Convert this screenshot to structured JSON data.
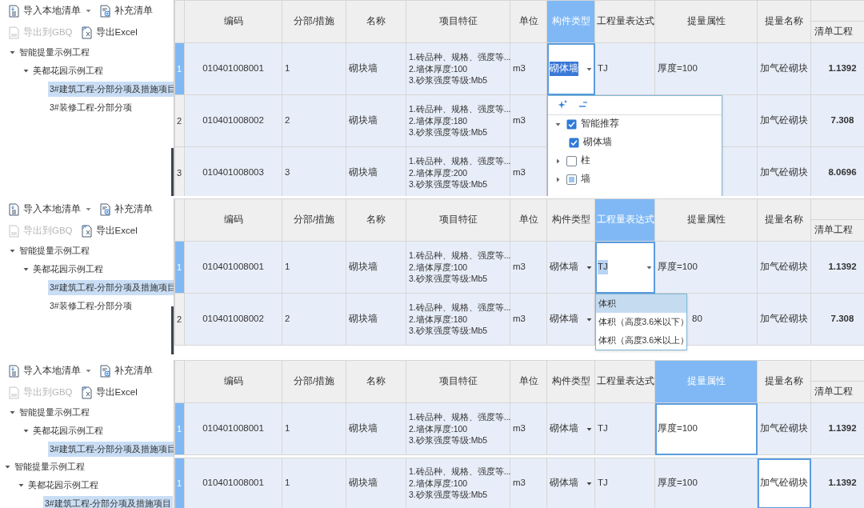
{
  "panels": [
    {
      "toolbar": [
        [
          {
            "label": "导入本地清单",
            "kind": "import",
            "dropdown": true,
            "disabled": false
          },
          {
            "label": "补充清单",
            "kind": "supplement",
            "disabled": false
          }
        ],
        [
          {
            "label": "导出到GBQ",
            "kind": "gbq",
            "disabled": true
          },
          {
            "label": "导出Excel",
            "kind": "excel",
            "disabled": false
          }
        ]
      ],
      "tree": [
        {
          "label": "智能提量示例工程",
          "expanded": true,
          "selected": false,
          "children": [
            {
              "label": "美都花园示例工程",
              "expanded": true,
              "selected": false,
              "children": [
                {
                  "label": "3#建筑工程-分部分项及措施项目",
                  "selected": true
                },
                {
                  "label": "3#装修工程-分部分项",
                  "selected": false
                }
              ]
            }
          ]
        }
      ],
      "columns": [
        {
          "label": "编码",
          "selected": false
        },
        {
          "label": "分部/措施",
          "selected": false
        },
        {
          "label": "名称",
          "selected": false
        },
        {
          "label": "项目特征",
          "selected": false
        },
        {
          "label": "单位",
          "selected": false
        },
        {
          "label": "构件类型",
          "selected": true
        },
        {
          "label": "工程量表达式",
          "selected": false
        },
        {
          "label": "提量属性",
          "selected": false
        },
        {
          "label": "提量名称",
          "selected": false
        },
        {
          "label": "清单工程",
          "selected": false
        }
      ],
      "rows": [
        {
          "number": "1",
          "selected": true,
          "cells": [
            "010401008001",
            "1",
            "砌块墙",
            "1.砖品种、规格、强度等...\n2.墙体厚度:100\n3.砂浆强度等级:Mb5",
            "m3",
            {
              "text": "砌体墙",
              "editing": true,
              "dropdown": true,
              "text_selected": true,
              "popup": {
                "kind": "tree",
                "items": [
                  {
                    "label": "智能推荐",
                    "expanded": true,
                    "checked": true,
                    "children": [
                      {
                        "label": "砌体墙",
                        "checked": true
                      }
                    ]
                  },
                  {
                    "label": "柱",
                    "expanded": false,
                    "checked": false
                  },
                  {
                    "label": "墙",
                    "expanded": false,
                    "checked": false,
                    "partial": true
                  }
                ]
              }
            },
            "TJ",
            "厚度=100",
            "加气砼砌块",
            "1.1392"
          ]
        },
        {
          "number": "2",
          "selected": false,
          "cells": [
            "010401008002",
            "2",
            "砌块墙",
            "1.砖品种、规格、强度等...\n2.墙体厚度:180\n3.砂浆强度等级:Mb5",
            "m3",
            null,
            null,
            null,
            "加气砼砌块",
            "7.308"
          ]
        },
        {
          "number": "3",
          "selected": false,
          "cells": [
            "010401008003",
            "3",
            "砌块墙",
            "1.砖品种、规格、强度等...\n2.墙体厚度:200\n3.砂浆强度等级:Mb5",
            "m3",
            null,
            null,
            null,
            "加气砼砌块",
            "8.0696"
          ]
        }
      ]
    },
    {
      "toolbar": [
        [
          {
            "label": "导入本地清单",
            "kind": "import",
            "dropdown": true,
            "disabled": false
          },
          {
            "label": "补充清单",
            "kind": "supplement",
            "disabled": false
          }
        ],
        [
          {
            "label": "导出到GBQ",
            "kind": "gbq",
            "disabled": true
          },
          {
            "label": "导出Excel",
            "kind": "excel",
            "disabled": false
          }
        ]
      ],
      "tree": [
        {
          "label": "智能提量示例工程",
          "expanded": true,
          "selected": false,
          "children": [
            {
              "label": "美都花园示例工程",
              "expanded": true,
              "selected": false,
              "children": [
                {
                  "label": "3#建筑工程-分部分项及措施项目",
                  "selected": true
                },
                {
                  "label": "3#装修工程-分部分项",
                  "selected": false
                }
              ]
            }
          ]
        }
      ],
      "columns": [
        {
          "label": "编码",
          "selected": false
        },
        {
          "label": "分部/措施",
          "selected": false
        },
        {
          "label": "名称",
          "selected": false
        },
        {
          "label": "项目特征",
          "selected": false
        },
        {
          "label": "单位",
          "selected": false
        },
        {
          "label": "构件类型",
          "selected": false
        },
        {
          "label": "工程量表达式",
          "selected": true
        },
        {
          "label": "提量属性",
          "selected": false
        },
        {
          "label": "提量名称",
          "selected": false
        },
        {
          "label": "清单工程",
          "selected": false
        }
      ],
      "rows": [
        {
          "number": "1",
          "selected": true,
          "cells": [
            "010401008001",
            "1",
            "砌块墙",
            "1.砖品种、规格、强度等...\n2.墙体厚度:100\n3.砂浆强度等级:Mb5",
            "m3",
            {
              "text": "砌体墙",
              "dropdown": true
            },
            {
              "text": "TJ",
              "editing": true,
              "dropdown": true,
              "text_selected": true,
              "popup": {
                "kind": "list",
                "items": [
                  {
                    "label": "体积",
                    "selected": true
                  },
                  {
                    "label": "体积（高度3.6米以下）",
                    "selected": false
                  },
                  {
                    "label": "体积（高度3.6米以上）",
                    "selected": false
                  }
                ]
              }
            },
            "厚度=100",
            "加气砼砌块",
            "1.1392"
          ]
        },
        {
          "number": "2",
          "selected": false,
          "cells": [
            "010401008002",
            "2",
            "砌块墙",
            "1.砖品种、规格、强度等...\n2.墙体厚度:180\n3.砂浆强度等级:Mb5",
            "m3",
            {
              "text": "砌体墙",
              "dropdown": true
            },
            null,
            {
              "text": "80",
              "covered": true
            },
            "加气砼砌块",
            "7.308"
          ]
        }
      ]
    },
    {
      "toolbar": [
        [
          {
            "label": "导入本地清单",
            "kind": "import",
            "dropdown": true,
            "disabled": false
          },
          {
            "label": "补充清单",
            "kind": "supplement",
            "disabled": false
          }
        ],
        [
          {
            "label": "导出到GBQ",
            "kind": "gbq",
            "disabled": true
          },
          {
            "label": "导出Excel",
            "kind": "excel",
            "disabled": false
          }
        ]
      ],
      "tree": [
        {
          "label": "智能提量示例工程",
          "expanded": true,
          "selected": false,
          "children": [
            {
              "label": "美都花园示例工程",
              "expanded": true,
              "selected": false,
              "children": [
                {
                  "label": "3#建筑工程-分部分项及措施项目",
                  "selected": true
                }
              ]
            }
          ]
        }
      ],
      "columns": [
        {
          "label": "编码",
          "selected": false
        },
        {
          "label": "分部/措施",
          "selected": false
        },
        {
          "label": "名称",
          "selected": false
        },
        {
          "label": "项目特征",
          "selected": false
        },
        {
          "label": "单位",
          "selected": false
        },
        {
          "label": "构件类型",
          "selected": false
        },
        {
          "label": "工程量表达式",
          "selected": false
        },
        {
          "label": "提量属性",
          "selected": true
        },
        {
          "label": "提量名称",
          "selected": false
        },
        {
          "label": "清单工程",
          "selected": false
        }
      ],
      "rows": [
        {
          "number": "1",
          "selected": true,
          "cells": [
            "010401008001",
            "1",
            "砌块墙",
            "1.砖品种、规格、强度等...\n2.墙体厚度:100\n3.砂浆强度等级:Mb5",
            "m3",
            {
              "text": "砌体墙",
              "dropdown": true
            },
            "TJ",
            {
              "text": "厚度=100",
              "editing": true
            },
            "加气砼砌块",
            "1.1392"
          ]
        }
      ]
    },
    {
      "tree": [
        {
          "label": "智能提量示例工程",
          "expanded": true,
          "selected": false,
          "children": [
            {
              "label": "美都花园示例工程",
              "expanded": true,
              "selected": false,
              "children": [
                {
                  "label": "3#建筑工程-分部分项及措施项目",
                  "selected": true
                }
              ]
            }
          ]
        }
      ],
      "rows": [
        {
          "number": "1",
          "selected": true,
          "cells": [
            "010401008001",
            "1",
            "砌块墙",
            "1.砖品种、规格、强度等...\n2.墙体厚度:100\n3.砂浆强度等级:Mb5",
            "m3",
            {
              "text": "砌体墙",
              "dropdown": true
            },
            "TJ",
            "厚度=100",
            {
              "text": "加气砼砌块",
              "editing": true
            },
            "1.1392"
          ]
        }
      ]
    }
  ]
}
